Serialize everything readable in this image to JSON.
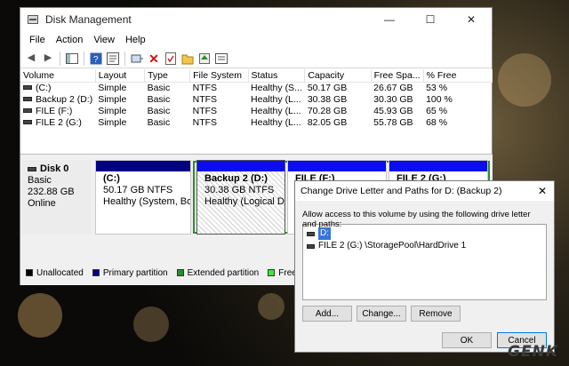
{
  "window": {
    "title": "Disk Management",
    "controls": {
      "minimize": "—",
      "maximize": "☐",
      "close": "✕"
    }
  },
  "menu": [
    "File",
    "Action",
    "View",
    "Help"
  ],
  "toolbar_icons": [
    "back-arrow-icon",
    "forward-arrow-icon",
    "console-tree-icon",
    "help-icon",
    "properties-icon",
    "connect-icon",
    "delete-icon",
    "check-icon",
    "folder-icon",
    "up-icon",
    "list-icon"
  ],
  "volume_table": {
    "headers": [
      "Volume",
      "Layout",
      "Type",
      "File System",
      "Status",
      "Capacity",
      "Free Spa...",
      "% Free"
    ],
    "rows": [
      [
        "(C:)",
        "Simple",
        "Basic",
        "NTFS",
        "Healthy (S...",
        "50.17 GB",
        "26.67 GB",
        "53 %"
      ],
      [
        "Backup 2 (D:)",
        "Simple",
        "Basic",
        "NTFS",
        "Healthy (L...",
        "30.38 GB",
        "30.30 GB",
        "100 %"
      ],
      [
        "FILE (F:)",
        "Simple",
        "Basic",
        "NTFS",
        "Healthy (L...",
        "70.28 GB",
        "45.93 GB",
        "65 %"
      ],
      [
        "FILE 2 (G:)",
        "Simple",
        "Basic",
        "NTFS",
        "Healthy (L...",
        "82.05 GB",
        "55.78 GB",
        "68 %"
      ]
    ]
  },
  "disk": {
    "name": "Disk 0",
    "type": "Basic",
    "size": "232.88 GB",
    "state": "Online",
    "partitions": [
      {
        "name": "(C:)",
        "size": "50.17 GB NTFS",
        "status": "Healthy (System, Boot, I"
      },
      {
        "name": "Backup 2  (D:)",
        "size": "30.38 GB NTFS",
        "status": "Healthy (Logical Drive"
      },
      {
        "name": "FILE  (F:)",
        "size": "",
        "status": ""
      },
      {
        "name": "FILE 2  (G:)",
        "size": "",
        "status": ""
      }
    ]
  },
  "legend": [
    {
      "label": "Unallocated",
      "color": "#000000"
    },
    {
      "label": "Primary partition",
      "color": "#000080"
    },
    {
      "label": "Extended partition",
      "color": "#2a8f2a"
    },
    {
      "label": "Free space",
      "color": "#33ee33"
    }
  ],
  "dialog": {
    "title": "Change Drive Letter and Paths for D: (Backup 2)",
    "close": "✕",
    "message": "Allow access to this volume by using the following drive letter and paths:",
    "items": [
      "D:",
      "FILE 2 (G:) \\StoragePool\\HardDrive 1"
    ],
    "buttons": {
      "add": "Add...",
      "change": "Change...",
      "remove": "Remove",
      "ok": "OK",
      "cancel": "Cancel"
    }
  },
  "watermark": "GENK"
}
